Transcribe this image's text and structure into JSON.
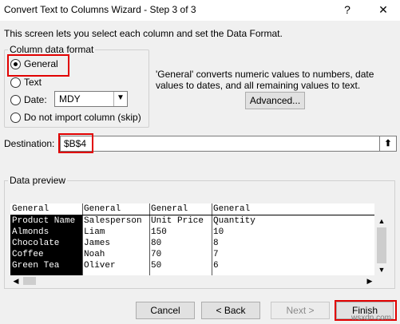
{
  "window": {
    "title": "Convert Text to Columns Wizard - Step 3 of 3",
    "help": "?",
    "close": "✕"
  },
  "description": "This screen lets you select each column and set the Data Format.",
  "format_group": {
    "legend": "Column data format",
    "options": [
      "General",
      "Text",
      "Date:",
      "Do not import column (skip)"
    ],
    "selected": "General",
    "date_value": "MDY"
  },
  "info_text": "'General' converts numeric values to numbers, date values to dates, and all remaining values to text.",
  "advanced_label": "Advanced...",
  "destination": {
    "label": "Destination:",
    "value": "$B$4"
  },
  "preview": {
    "label": "Data preview",
    "headers": [
      "General",
      "General",
      "General",
      "General"
    ],
    "rows": [
      [
        "Product Name",
        "Salesperson",
        "Unit Price",
        "Quantity"
      ],
      [
        "Almonds",
        "Liam",
        "150",
        "10"
      ],
      [
        "Chocolate",
        "James",
        "80",
        "8"
      ],
      [
        "Coffee",
        "Noah",
        "70",
        "7"
      ],
      [
        "Green Tea",
        "Oliver",
        "50",
        "6"
      ]
    ]
  },
  "buttons": {
    "cancel": "Cancel",
    "back": "< Back",
    "next": "Next >",
    "finish": "Finish"
  },
  "watermark": "wsxdn.com",
  "colors": {
    "highlight": "#e10000",
    "selected_column": "#000000"
  }
}
